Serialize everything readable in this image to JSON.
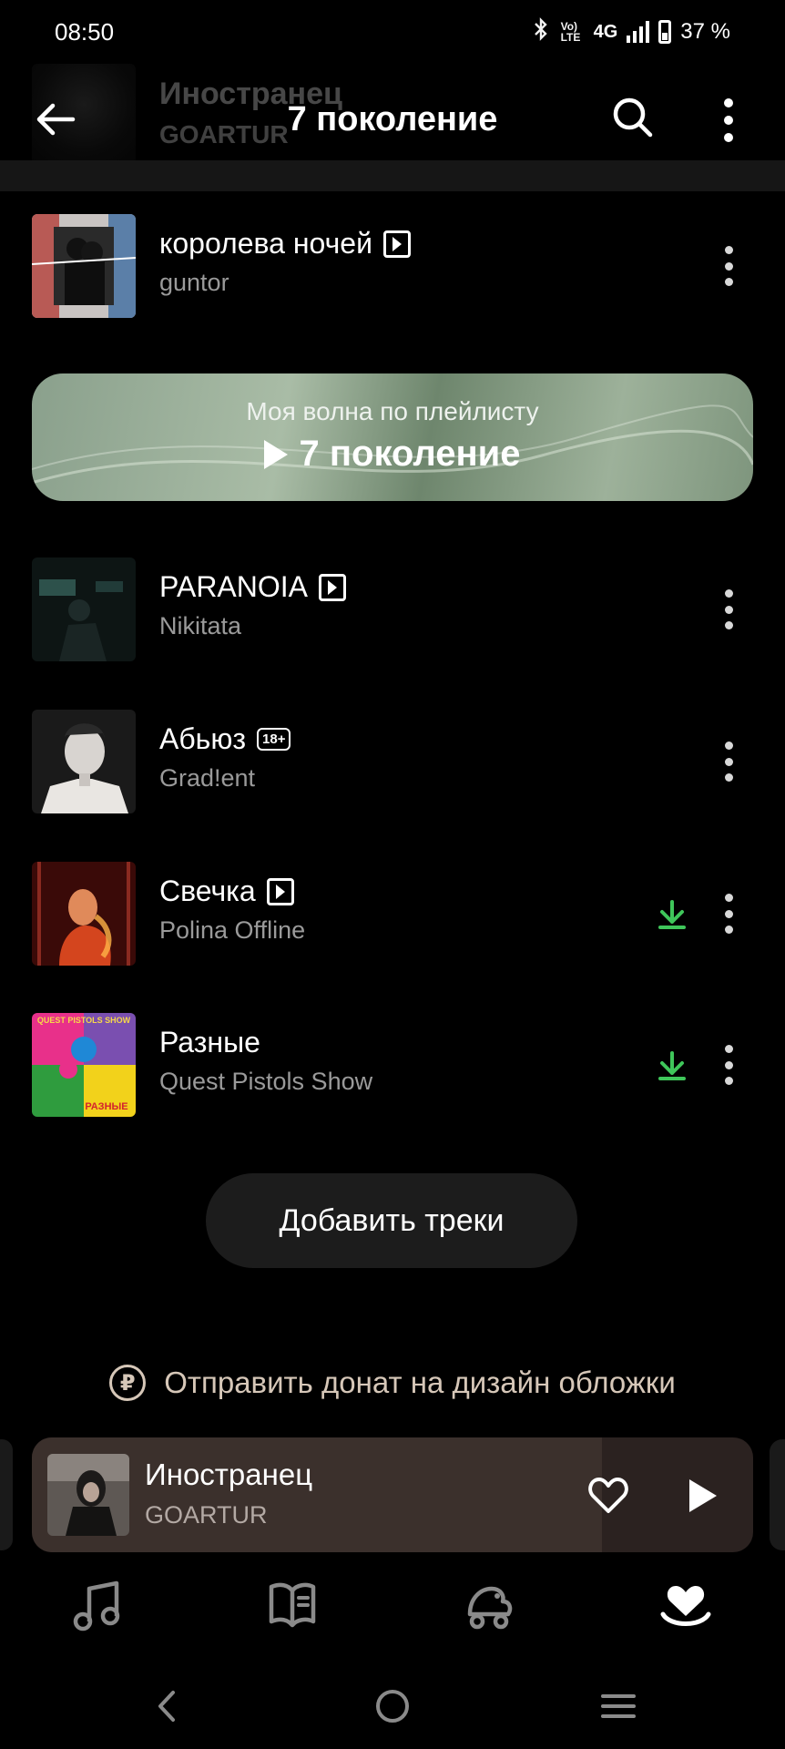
{
  "status_bar": {
    "time": "08:50",
    "network": "4G",
    "volte": "Vo) LTE",
    "battery": "37 %"
  },
  "header": {
    "title": "7 поколение",
    "ghost_track": {
      "title": "Иностранец",
      "artist": "GOARTUR"
    }
  },
  "tracks": [
    {
      "title": "королева ночей",
      "artist": "guntor",
      "badge": "video",
      "downloaded": false
    },
    {
      "title": "PARANOIA",
      "artist": "Nikitata",
      "badge": "video",
      "downloaded": false
    },
    {
      "title": "Абьюз",
      "artist": "Grad!ent",
      "badge": "18+",
      "downloaded": false
    },
    {
      "title": "Свечка",
      "artist": "Polina Offline",
      "badge": "video",
      "downloaded": true
    },
    {
      "title": "Разные",
      "artist": "Quest Pistols Show",
      "badge": "",
      "downloaded": true
    }
  ],
  "covers": {
    "raznye_top": "QUEST PISTOLS SHOW",
    "raznye_bottom": "РАЗНЫЕ"
  },
  "wave": {
    "subtitle": "Моя волна по плейлисту",
    "title": "7 поколение"
  },
  "add_tracks_label": "Добавить треки",
  "donate_label": "Отправить донат на дизайн обложки",
  "donate_symbol": "₽",
  "mini_player": {
    "title": "Иностранец",
    "artist": "GOARTUR",
    "progress": 0.79
  },
  "tabs": [
    "music-note-icon",
    "book-icon",
    "kids-icon",
    "collection-heart-icon"
  ],
  "colors": {
    "accent_green": "#3fc65a",
    "background": "#000000",
    "wave_green": "#8fa68e",
    "donate_tan": "#d6c7b8"
  }
}
